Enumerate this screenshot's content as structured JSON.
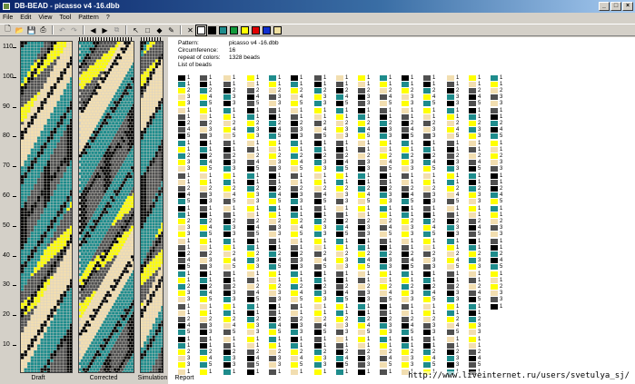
{
  "window": {
    "title": "DB-BEAD - picasso v4 -16.dbb",
    "controls": [
      "_",
      "□",
      "×"
    ]
  },
  "menu": [
    "File",
    "Edit",
    "View",
    "Tool",
    "Pattern",
    "?"
  ],
  "toolbar": {
    "icons": [
      "new-icon",
      "open-icon",
      "save-icon",
      "print-icon",
      "undo-icon",
      "redo-icon",
      "arrow-left-icon",
      "arrow-right-icon",
      "copy-icon",
      "pointer-icon",
      "select-rect-icon",
      "fill-icon",
      "pipette-icon"
    ],
    "colors": [
      "#ffffff",
      "#000000",
      "#1e8c8c",
      "#129a3c",
      "#ffff00",
      "#e00000",
      "#1030d0",
      "#f0e0a0"
    ]
  },
  "ruler": {
    "labels": [
      "110",
      "100",
      "90",
      "80",
      "70",
      "60",
      "50",
      "40",
      "30",
      "20",
      "10"
    ]
  },
  "views": {
    "draft": "Draft",
    "corrected": "Corrected",
    "simulation": "Simulation",
    "report": "Report"
  },
  "palette": {
    "teal": "#1e8c8c",
    "yellow": "#ffff00",
    "beige": "#f2deb0",
    "black": "#000000",
    "gray": "#505050"
  },
  "report": {
    "pattern_label": "Pattern:",
    "pattern_value": "picasso v4 -16.dbb",
    "circ_label": "Circumference:",
    "circ_value": "16",
    "repeat_label": "repeat of colors:",
    "repeat_value": "1328 beads",
    "list_label": "List of beads"
  },
  "watermark": "http://www.liveinternet.ru/users/svetulya_sj/"
}
